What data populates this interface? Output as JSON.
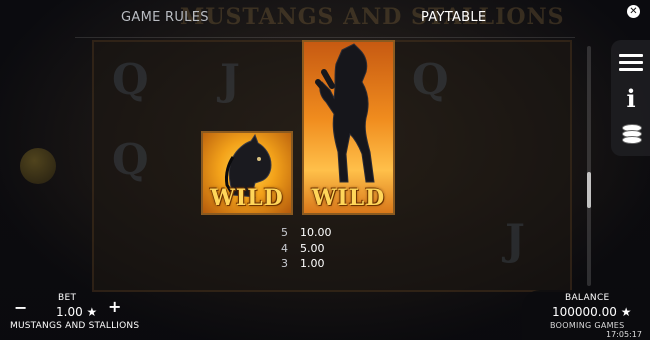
{
  "header": {
    "tabs": [
      {
        "label": "GAME RULES",
        "active": false
      },
      {
        "label": "PAYTABLE",
        "active": true
      }
    ],
    "background_logo": "MUSTANGS AND STALLIONS",
    "close_icon": "close-icon"
  },
  "side_menu": {
    "items": [
      {
        "icon": "menu-icon"
      },
      {
        "icon": "info-icon"
      },
      {
        "icon": "coins-stack-icon"
      }
    ]
  },
  "background_reels": [
    "Q",
    "J",
    "Q",
    "Q",
    "J"
  ],
  "paytable": {
    "symbols": [
      {
        "name": "horse-head-wild",
        "label": "WILD"
      },
      {
        "name": "rearing-stallion-wild",
        "label": "WILD"
      }
    ],
    "pays": [
      {
        "count": "5",
        "value": "10.00"
      },
      {
        "count": "4",
        "value": "5.00"
      },
      {
        "count": "3",
        "value": "1.00"
      }
    ]
  },
  "footer": {
    "bet_label": "BET",
    "bet_value": "1.00 ★",
    "minus": "−",
    "plus": "+",
    "game_name": "MUSTANGS AND STALLIONS",
    "balance_label": "BALANCE",
    "balance_value": "100000.00 ★",
    "provider": "BOOMING GAMES",
    "clock": "17:05:17"
  },
  "colors": {
    "wild_text": "#ffd65a",
    "symbol_border": "#8a5a20",
    "panel_bg": "#0c0c0e"
  }
}
